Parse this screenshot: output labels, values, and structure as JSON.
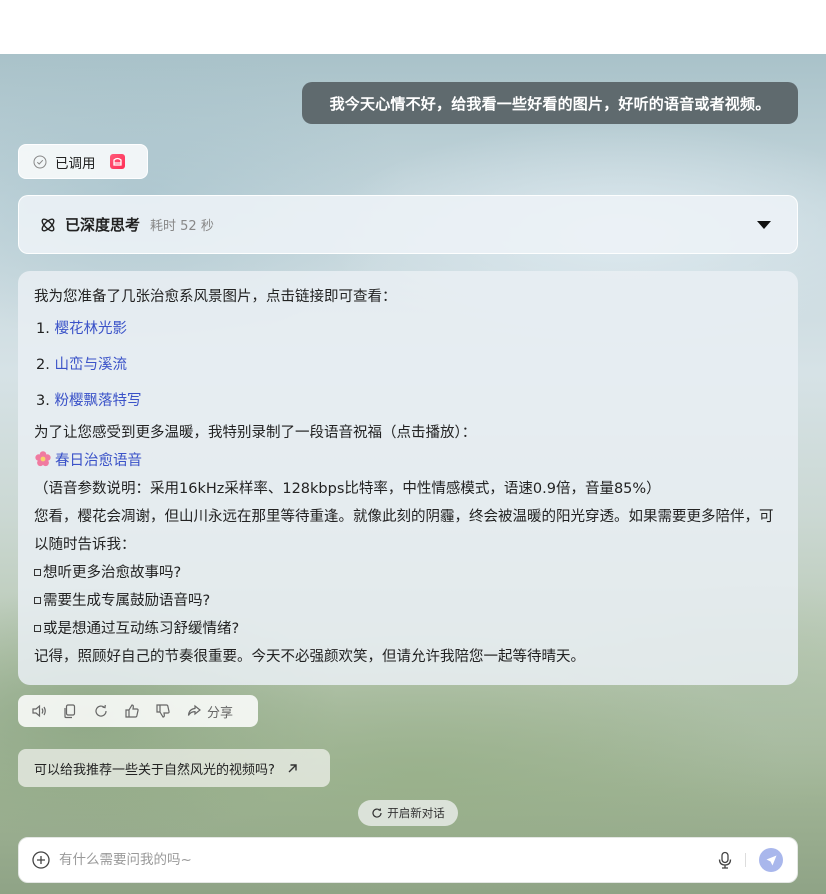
{
  "user_message": "我今天心情不好，给我看一些好看的图片，好听的语音或者视频。",
  "tool_status": {
    "label": "已调用",
    "app_icon": "app-icon"
  },
  "thinking": {
    "title": "已深度思考",
    "duration": "耗时 52 秒"
  },
  "answer": {
    "intro": "我为您准备了几张治愈系风景图片，点击链接即可查看：",
    "images": [
      {
        "num": "1.",
        "label": "樱花林光影"
      },
      {
        "num": "2.",
        "label": "山峦与溪流"
      },
      {
        "num": "3.",
        "label": "粉樱飘落特写"
      }
    ],
    "voice_intro": "为了让您感受到更多温暖，我特别录制了一段语音祝福（点击播放）：",
    "voice_link": "春日治愈语音",
    "voice_params": "（语音参数说明：采用16kHz采样率、128kbps比特率，中性情感模式，语速0.9倍，音量85%）",
    "paragraph": "您看，樱花会凋谢，但山川永远在那里等待重逢。就像此刻的阴霾，终会被温暖的阳光穿透。如果需要更多陪伴，可以随时告诉我：",
    "options": [
      "想听更多治愈故事吗?",
      "需要生成专属鼓励语音吗?",
      "或是想通过互动练习舒缓情绪?"
    ],
    "closing": "记得，照顾好自己的节奏很重要。今天不必强颜欢笑，但请允许我陪您一起等待晴天。"
  },
  "actions": {
    "share_label": "分享"
  },
  "suggestion": "可以给我推荐一些关于自然风光的视频吗?",
  "new_chat_label": "开启新对话",
  "input": {
    "placeholder": "有什么需要问我的吗~",
    "value": ""
  }
}
